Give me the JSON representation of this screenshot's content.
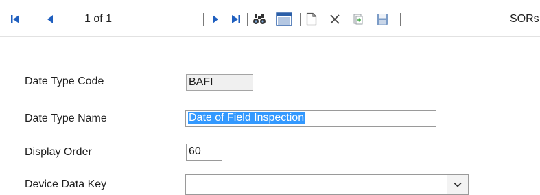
{
  "toolbar": {
    "first_icon": "first-record-icon",
    "prev_icon": "previous-record-icon",
    "page_text": "1 of 1",
    "next_icon": "next-record-icon",
    "last_icon": "last-record-icon",
    "find_icon": "binoculars-find-icon",
    "list_icon": "list-view-icon",
    "new_icon": "new-document-icon",
    "delete_icon": "delete-x-icon",
    "copy_icon": "copy-record-icon",
    "save_icon": "save-floppy-icon",
    "sors_prefix": "S",
    "sors_underlined": "O",
    "sors_suffix": "Rs"
  },
  "form": {
    "date_type_code": {
      "label": "Date Type Code",
      "value": "BAFI"
    },
    "date_type_name": {
      "label": "Date Type Name",
      "value": "Date of Field Inspection"
    },
    "display_order": {
      "label": "Display Order",
      "value": "60"
    },
    "device_data_key": {
      "label": "Device Data Key",
      "value": "",
      "dropdown_icon": "chevron-down-icon"
    }
  },
  "colors": {
    "accent": "#1f5fbf",
    "selection": "#3399ff"
  }
}
